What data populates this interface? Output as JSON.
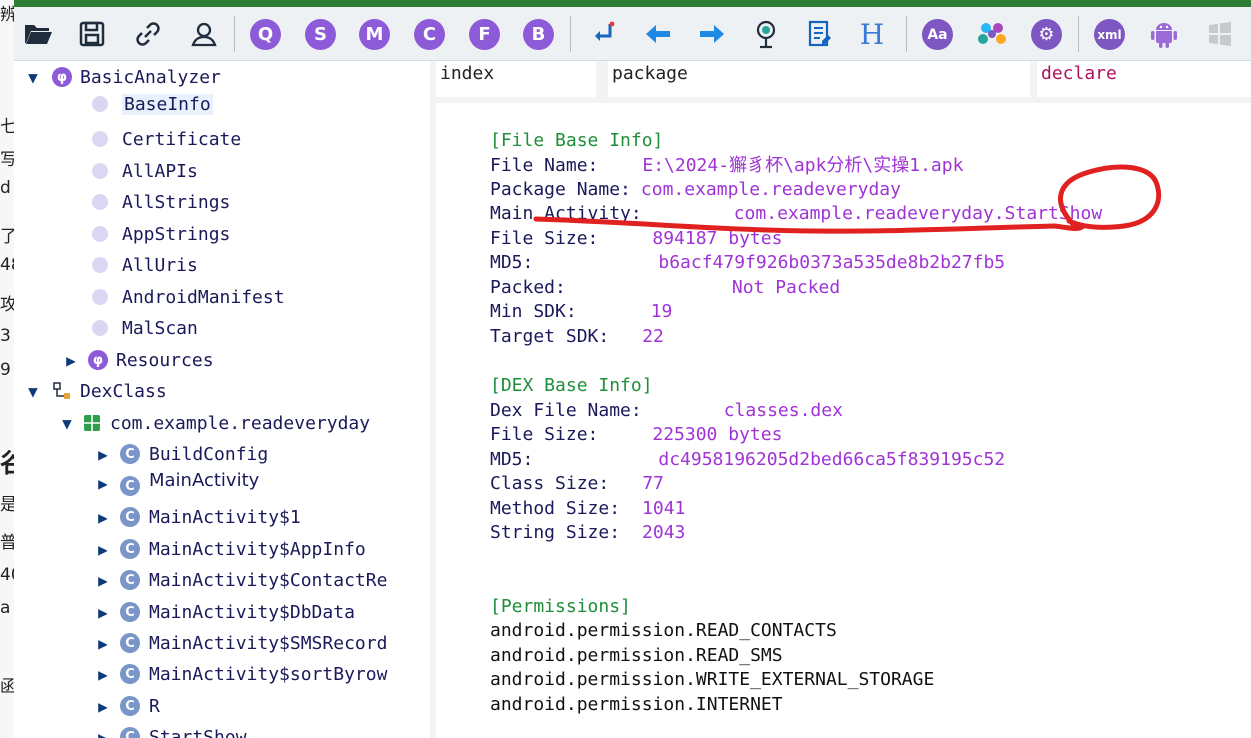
{
  "background_window": {
    "fragments": [
      "辨",
      "",
      "七",
      "写",
      "d",
      "了",
      "48",
      "攻",
      "3",
      "9",
      "",
      "谷",
      "是",
      "普",
      "40",
      "a",
      "",
      "函"
    ]
  },
  "toolbar": {
    "buttons": [
      {
        "name": "open-folder-icon",
        "glyph": "📂"
      },
      {
        "name": "save-icon",
        "glyph": "💾"
      },
      {
        "name": "link-icon",
        "glyph": "🔗"
      },
      {
        "name": "user-sync-icon",
        "glyph": "👤"
      },
      {
        "name": "q-circle-icon",
        "glyph": "Q"
      },
      {
        "name": "s-circle-icon",
        "glyph": "S"
      },
      {
        "name": "m-circle-icon",
        "glyph": "M"
      },
      {
        "name": "c-circle-icon",
        "glyph": "C"
      },
      {
        "name": "f-circle-icon",
        "glyph": "F"
      },
      {
        "name": "b-circle-icon",
        "glyph": "B"
      },
      {
        "name": "return-arrow-icon",
        "glyph": "↲"
      },
      {
        "name": "arrow-left-icon",
        "glyph": "⬅"
      },
      {
        "name": "arrow-right-icon",
        "glyph": "➡"
      },
      {
        "name": "pin-icon",
        "glyph": "📍"
      },
      {
        "name": "report-icon",
        "glyph": "📝"
      },
      {
        "name": "h-heading-icon",
        "glyph": "H"
      },
      {
        "name": "font-aa-icon",
        "glyph": "Aa"
      },
      {
        "name": "palette-icon",
        "glyph": "✿"
      },
      {
        "name": "settings-gear-icon",
        "glyph": "⚙"
      },
      {
        "name": "xml-icon",
        "glyph": "xml"
      },
      {
        "name": "android-icon",
        "glyph": "🤖"
      },
      {
        "name": "windows-icon",
        "glyph": "⊞"
      }
    ]
  },
  "tree": {
    "basic_analyzer": "BasicAnalyzer",
    "base_info": "BaseInfo",
    "certificate": "Certificate",
    "all_apis": "AllAPIs",
    "all_strings": "AllStrings",
    "app_strings": "AppStrings",
    "all_uris": "AllUris",
    "android_manifest": "AndroidManifest",
    "mal_scan": "MalScan",
    "resources": "Resources",
    "dex_class": "DexClass",
    "package": "com.example.readeveryday",
    "classes": [
      "BuildConfig",
      "MainActivity",
      "MainActivity$1",
      "MainActivity$AppInfo",
      "MainActivity$ContactRe",
      "MainActivity$DbData",
      "MainActivity$SMSRecord",
      "MainActivity$sortByrow",
      "R",
      "StartShow"
    ]
  },
  "table_header": {
    "col_index": "index",
    "col_package": "package",
    "col_declare": "declare"
  },
  "file_base_info": {
    "title": "[File Base Info]",
    "file_name_key": "File Name:",
    "file_name_val": "E:\\2024-獬豸杯\\apk分析\\实操1.apk",
    "package_name_key": "Package Name:",
    "package_name_val": "com.example.readeveryday",
    "main_activity_key": "Main Activity:",
    "main_activity_val": "com.example.readeveryday.StartShow",
    "file_size_key": "File Size:",
    "file_size_val": "894187 bytes",
    "md5_key": "MD5:",
    "md5_val": "b6acf479f926b0373a535de8b2b27fb5",
    "packed_key": "Packed:",
    "packed_val": "Not Packed",
    "min_sdk_key": "Min SDK:",
    "min_sdk_val": "19",
    "target_sdk_key": "Target SDK:",
    "target_sdk_val": "22"
  },
  "dex_base_info": {
    "title": "[DEX Base Info]",
    "dex_file_name_key": "Dex File Name:",
    "dex_file_name_val": "classes.dex",
    "file_size_key": "File Size:",
    "file_size_val": "225300 bytes",
    "md5_key": "MD5:",
    "md5_val": "dc4958196205d2bed66ca5f839195c52",
    "class_size_key": "Class Size:",
    "class_size_val": "77",
    "method_size_key": "Method Size:",
    "method_size_val": "1041",
    "string_size_key": "String Size:",
    "string_size_val": "2043"
  },
  "permissions": {
    "title": "[Permissions]",
    "items": [
      "android.permission.READ_CONTACTS",
      "android.permission.READ_SMS",
      "android.permission.WRITE_EXTERNAL_STORAGE",
      "android.permission.INTERNET"
    ]
  },
  "colors": {
    "annotation": "#e0211f",
    "value": "#a033d6",
    "section": "#1e8f3a",
    "accent_purple": "#8e5bd8"
  }
}
